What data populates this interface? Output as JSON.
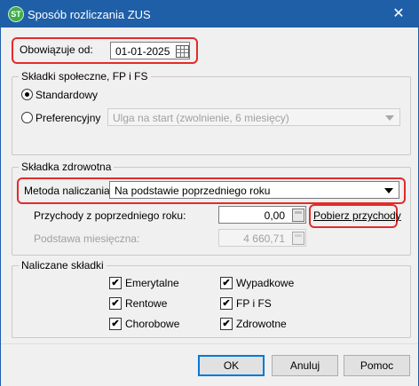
{
  "window": {
    "title": "Sposób rozliczania ZUS",
    "icon": "app-logo-icon",
    "close_glyph": "✕"
  },
  "effective": {
    "label": "Obowiązuje od:",
    "date": "01-01-2025"
  },
  "social": {
    "title": "Składki społeczne, FP i FS",
    "standard_label": "Standardowy",
    "preferential_label": "Preferencyjny",
    "preferential_value": "Ulga na start (zwolnienie, 6 miesięcy)"
  },
  "health": {
    "title": "Składka zdrowotna",
    "method_label": "Metoda naliczania",
    "method_value": "Na podstawie poprzedniego roku",
    "income_label": "Przychody z poprzedniego roku:",
    "income_value": "0,00",
    "fetch_link": "Pobierz przychody",
    "base_label": "Podstawa miesięczna:",
    "base_value": "4 660,71"
  },
  "contributions": {
    "title": "Naliczane składki",
    "items": [
      {
        "label": "Emerytalne",
        "checked": true
      },
      {
        "label": "Wypadkowe",
        "checked": true
      },
      {
        "label": "Rentowe",
        "checked": true
      },
      {
        "label": "FP i FS",
        "checked": true
      },
      {
        "label": "Chorobowe",
        "checked": true
      },
      {
        "label": "Zdrowotne",
        "checked": true
      }
    ],
    "check_glyph": "✔"
  },
  "buttons": {
    "ok": "OK",
    "cancel": "Anuluj",
    "help": "Pomoc"
  },
  "colors": {
    "titlebar": "#1f5fa8",
    "highlight": "#e32b2b",
    "focus": "#0078d7"
  }
}
